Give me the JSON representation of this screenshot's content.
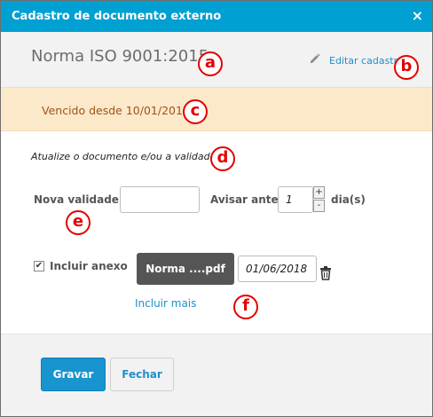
{
  "window": {
    "title": "Cadastro de documento externo",
    "close_glyph": "×"
  },
  "header": {
    "doc_name": "Norma ISO 9001:2015",
    "edit_label": "Editar cadastro",
    "edit_icon": "pencil-icon"
  },
  "warning": {
    "text": "Vencido desde 10/01/2019."
  },
  "form": {
    "instruction": "Atualize o documento e/ou a validade",
    "validity_label": "Nova validade",
    "validity_value": "",
    "notify_label": "Avisar antes",
    "notify_value": "1",
    "stepper_up": "+",
    "stepper_down": "-",
    "days_label": "dia(s)",
    "attach_checked": true,
    "attach_check_glyph": "✔",
    "attach_label": "Incluir anexo",
    "file_button": "Norma ....pdf",
    "file_date": "01/06/2018",
    "trash_icon": "trash-icon",
    "add_more": "Incluir mais"
  },
  "footer": {
    "save_label": "Gravar",
    "close_label": "Fechar"
  },
  "markers": [
    "a",
    "b",
    "c",
    "d",
    "e",
    "f"
  ],
  "colors": {
    "accent": "#00a0d2",
    "warning_bg": "#fbe9c9",
    "warning_text": "#a0531c",
    "link": "#1e90c9",
    "marker": "#e30000"
  }
}
